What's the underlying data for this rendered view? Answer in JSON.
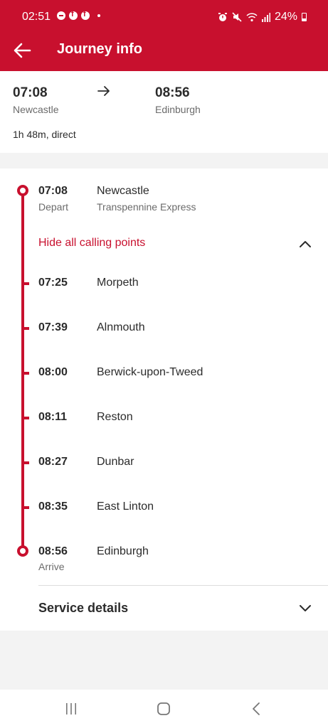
{
  "status_bar": {
    "time": "02:51",
    "battery": "24%"
  },
  "header": {
    "title": "Journey info"
  },
  "summary": {
    "depart_time": "07:08",
    "depart_place": "Newcastle",
    "arrive_time": "08:56",
    "arrive_place": "Edinburgh",
    "duration": "1h 48m, direct"
  },
  "journey": {
    "origin": {
      "time": "07:08",
      "label": "Depart",
      "station": "Newcastle",
      "operator": "Transpennine Express"
    },
    "toggle_label": "Hide all calling points",
    "calling_points": [
      {
        "time": "07:25",
        "station": "Morpeth"
      },
      {
        "time": "07:39",
        "station": "Alnmouth"
      },
      {
        "time": "08:00",
        "station": "Berwick-upon-Tweed"
      },
      {
        "time": "08:11",
        "station": "Reston"
      },
      {
        "time": "08:27",
        "station": "Dunbar"
      },
      {
        "time": "08:35",
        "station": "East Linton"
      }
    ],
    "destination": {
      "time": "08:56",
      "label": "Arrive",
      "station": "Edinburgh"
    },
    "service_details": "Service details"
  },
  "colors": {
    "brand": "#c8102e",
    "text": "#2b2b2b",
    "muted": "#6b6b6b"
  },
  "icons": [
    "back-arrow-icon",
    "right-arrow-icon",
    "chevron-up-icon",
    "chevron-down-icon",
    "recent-apps-icon",
    "home-icon",
    "nav-back-icon"
  ]
}
